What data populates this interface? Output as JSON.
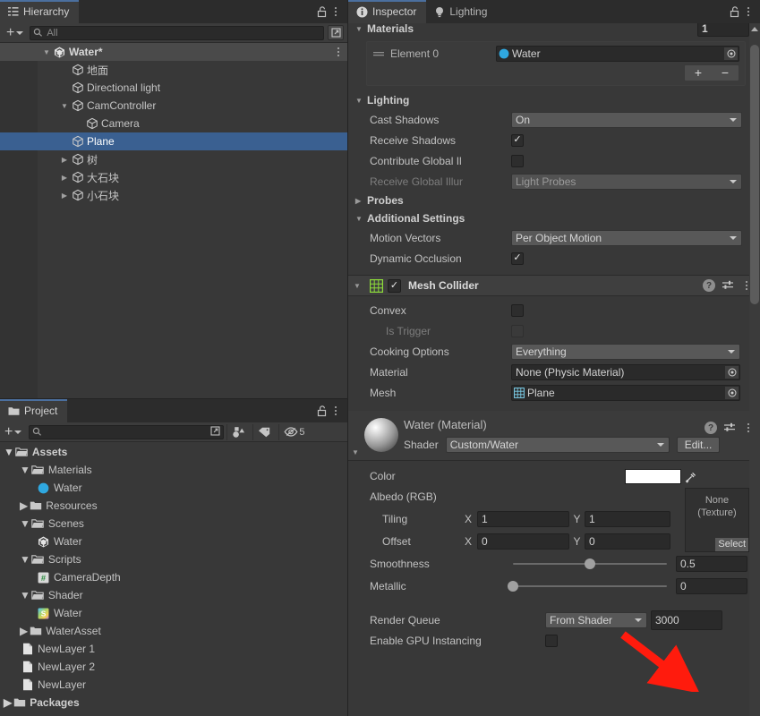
{
  "hierarchy": {
    "tab_label": "Hierarchy",
    "search_placeholder": "All",
    "scene_name": "Water*",
    "items": [
      {
        "label": "地面",
        "depth": 2,
        "arrow": "none",
        "icon": "cube-icon",
        "selected": false
      },
      {
        "label": "Directional light",
        "depth": 2,
        "arrow": "none",
        "icon": "cube-icon",
        "selected": false
      },
      {
        "label": "CamController",
        "depth": 2,
        "arrow": "open",
        "icon": "cube-icon",
        "selected": false
      },
      {
        "label": "Camera",
        "depth": 3,
        "arrow": "none",
        "icon": "cube-icon",
        "selected": false
      },
      {
        "label": "Plane",
        "depth": 2,
        "arrow": "none",
        "icon": "cube-icon",
        "selected": true
      },
      {
        "label": "树",
        "depth": 2,
        "arrow": "closed",
        "icon": "cube-icon",
        "selected": false
      },
      {
        "label": "大石块",
        "depth": 2,
        "arrow": "closed",
        "icon": "cube-icon",
        "selected": false
      },
      {
        "label": "小石块",
        "depth": 2,
        "arrow": "closed",
        "icon": "cube-icon",
        "selected": false
      }
    ]
  },
  "project": {
    "tab_label": "Project",
    "search_placeholder": "",
    "hidden_count": "5",
    "items": [
      {
        "label": "Assets",
        "depth": 0,
        "arrow": "open",
        "icon": "folder-open-icon",
        "bold": true
      },
      {
        "label": "Materials",
        "depth": 1,
        "arrow": "open",
        "icon": "folder-open-icon",
        "bold": false
      },
      {
        "label": "Water",
        "depth": 2,
        "arrow": "none",
        "icon": "material-icon",
        "bold": false
      },
      {
        "label": "Resources",
        "depth": 1,
        "arrow": "closed",
        "icon": "folder-icon",
        "bold": false
      },
      {
        "label": "Scenes",
        "depth": 1,
        "arrow": "open",
        "icon": "folder-open-icon",
        "bold": false
      },
      {
        "label": "Water",
        "depth": 2,
        "arrow": "none",
        "icon": "unity-scene-icon",
        "bold": false
      },
      {
        "label": "Scripts",
        "depth": 1,
        "arrow": "open",
        "icon": "folder-open-icon",
        "bold": false
      },
      {
        "label": "CameraDepth",
        "depth": 2,
        "arrow": "none",
        "icon": "csharp-script-icon",
        "bold": false
      },
      {
        "label": "Shader",
        "depth": 1,
        "arrow": "open",
        "icon": "folder-open-icon",
        "bold": false
      },
      {
        "label": "Water",
        "depth": 2,
        "arrow": "none",
        "icon": "shader-icon",
        "bold": false
      },
      {
        "label": "WaterAsset",
        "depth": 1,
        "arrow": "closed",
        "icon": "folder-icon",
        "bold": false
      },
      {
        "label": "NewLayer 1",
        "depth": 1,
        "arrow": "none",
        "icon": "file-icon",
        "bold": false
      },
      {
        "label": "NewLayer 2",
        "depth": 1,
        "arrow": "none",
        "icon": "file-icon",
        "bold": false
      },
      {
        "label": "NewLayer",
        "depth": 1,
        "arrow": "none",
        "icon": "file-icon",
        "bold": false
      },
      {
        "label": "Packages",
        "depth": 0,
        "arrow": "closed",
        "icon": "folder-icon",
        "bold": true
      }
    ]
  },
  "inspector": {
    "tab_label": "Inspector",
    "lighting_tab_label": "Lighting",
    "materials": {
      "header": "Materials",
      "size": "1",
      "element_label": "Element 0",
      "element_value": "Water",
      "add_label": "+",
      "remove_label": "−"
    },
    "lighting": {
      "header": "Lighting",
      "cast_shadows_label": "Cast Shadows",
      "cast_shadows_value": "On",
      "receive_shadows_label": "Receive Shadows",
      "receive_shadows_checked": true,
      "contribute_gi_label": "Contribute Global Il",
      "contribute_gi_checked": false,
      "receive_gi_label": "Receive Global Illur",
      "receive_gi_value": "Light Probes"
    },
    "probes_header": "Probes",
    "additional": {
      "header": "Additional Settings",
      "motion_vectors_label": "Motion Vectors",
      "motion_vectors_value": "Per Object Motion",
      "dynamic_occlusion_label": "Dynamic Occlusion",
      "dynamic_occlusion_checked": true
    },
    "mesh_collider": {
      "title": "Mesh Collider",
      "enabled": true,
      "convex_label": "Convex",
      "convex_checked": false,
      "is_trigger_label": "Is Trigger",
      "is_trigger_checked": false,
      "cooking_options_label": "Cooking Options",
      "cooking_options_value": "Everything",
      "material_label": "Material",
      "material_value": "None (Physic Material)",
      "mesh_label": "Mesh",
      "mesh_value": "Plane"
    },
    "material": {
      "title": "Water (Material)",
      "shader_label": "Shader",
      "shader_value": "Custom/Water",
      "edit_label": "Edit...",
      "color_label": "Color",
      "color_value": "#FFFFFF",
      "albedo_label": "Albedo (RGB)",
      "texture_none_line1": "None",
      "texture_none_line2": "(Texture)",
      "select_label": "Select",
      "tiling_label": "Tiling",
      "tiling_x": "1",
      "tiling_y": "1",
      "offset_label": "Offset",
      "offset_x": "0",
      "offset_y": "0",
      "axis_x": "X",
      "axis_y": "Y",
      "smoothness_label": "Smoothness",
      "smoothness_value": "0.5",
      "smoothness_pct": 50,
      "metallic_label": "Metallic",
      "metallic_value": "0",
      "metallic_pct": 0,
      "render_queue_label": "Render Queue",
      "render_queue_mode": "From Shader",
      "render_queue_value": "3000",
      "gpu_instancing_label": "Enable GPU Instancing"
    }
  },
  "annotation": {
    "arrow_color": "#FF1B0D"
  }
}
